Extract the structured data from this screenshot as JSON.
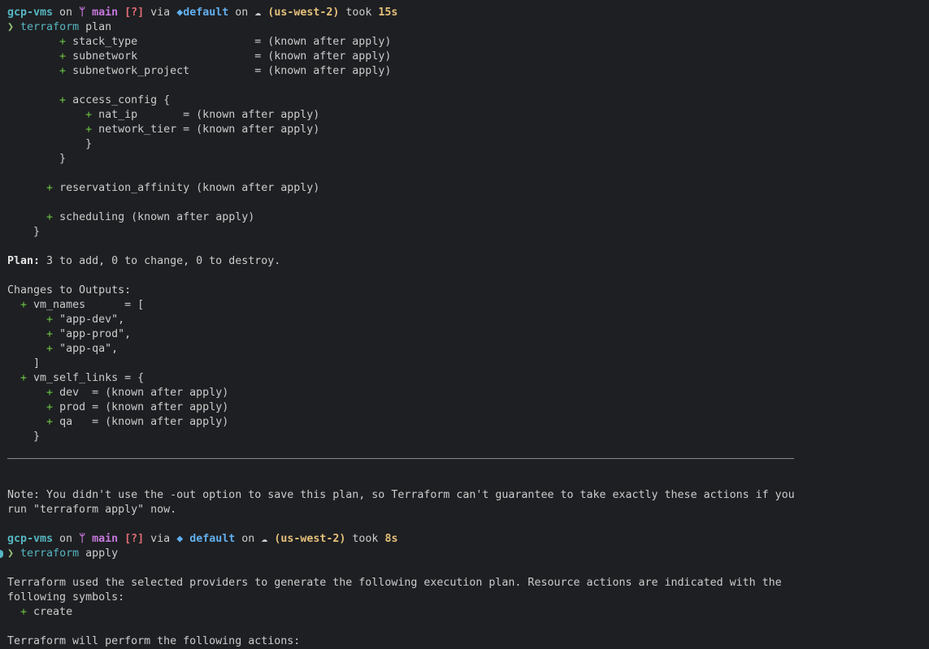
{
  "prompt1": {
    "dir": "gcp-vms",
    "on": " on ",
    "branch_icon": "ᛘ",
    "branch": "main",
    "status": "[?]",
    "via": " via ",
    "ws_icon": "◆",
    "workspace": "default",
    "on2": " on ",
    "cloud_icon": "☁",
    "region": "(us-west-2)",
    "took": " took ",
    "duration": "15s",
    "arrow": "❯",
    "cmd": "terraform",
    "cmd_arg": " plan"
  },
  "plan_lines": [
    {
      "indent": "        ",
      "plus": "+",
      "text": " stack_type                  = (known after apply)"
    },
    {
      "indent": "        ",
      "plus": "+",
      "text": " subnetwork                  = (known after apply)"
    },
    {
      "indent": "        ",
      "plus": "+",
      "text": " subnetwork_project          = (known after apply)"
    },
    {
      "indent": "",
      "plus": "",
      "text": ""
    },
    {
      "indent": "        ",
      "plus": "+",
      "text": " access_config {"
    },
    {
      "indent": "            ",
      "plus": "+",
      "text": " nat_ip       = (known after apply)"
    },
    {
      "indent": "            ",
      "plus": "+",
      "text": " network_tier = (known after apply)"
    },
    {
      "indent": "",
      "plus": "",
      "text": "            }"
    },
    {
      "indent": "",
      "plus": "",
      "text": "        }"
    },
    {
      "indent": "",
      "plus": "",
      "text": ""
    },
    {
      "indent": "      ",
      "plus": "+",
      "text": " reservation_affinity (known after apply)"
    },
    {
      "indent": "",
      "plus": "",
      "text": ""
    },
    {
      "indent": "      ",
      "plus": "+",
      "text": " scheduling (known after apply)"
    },
    {
      "indent": "",
      "plus": "",
      "text": "    }"
    }
  ],
  "plan_summary": {
    "label": "Plan:",
    "text": " 3 to add, 0 to change, 0 to destroy."
  },
  "outputs_header": "Changes to Outputs:",
  "output_lines": [
    {
      "indent": "  ",
      "plus": "+",
      "text": " vm_names      = ["
    },
    {
      "indent": "      ",
      "plus": "+",
      "text": " \"app-dev\","
    },
    {
      "indent": "      ",
      "plus": "+",
      "text": " \"app-prod\","
    },
    {
      "indent": "      ",
      "plus": "+",
      "text": " \"app-qa\","
    },
    {
      "indent": "",
      "plus": "",
      "text": "    ]"
    },
    {
      "indent": "  ",
      "plus": "+",
      "text": " vm_self_links = {"
    },
    {
      "indent": "      ",
      "plus": "+",
      "text": " dev  = (known after apply)"
    },
    {
      "indent": "      ",
      "plus": "+",
      "text": " prod = (known after apply)"
    },
    {
      "indent": "      ",
      "plus": "+",
      "text": " qa   = (known after apply)"
    },
    {
      "indent": "",
      "plus": "",
      "text": "    }"
    }
  ],
  "note": [
    "Note: You didn't use the -out option to save this plan, so Terraform can't guarantee to take exactly these actions if you",
    "run \"terraform apply\" now."
  ],
  "prompt2": {
    "dir": "gcp-vms",
    "on": " on ",
    "branch_icon": "ᛘ",
    "branch": "main",
    "status": "[?]",
    "via": " via ",
    "ws_icon": "◆",
    "workspace": "default",
    "on2": " on ",
    "cloud_icon": "☁",
    "region": "(us-west-2)",
    "took": " took ",
    "duration": "8s",
    "arrow": "❯",
    "cmd": "terraform",
    "cmd_arg": " apply"
  },
  "apply_text": [
    "Terraform used the selected providers to generate the following execution plan. Resource actions are indicated with the",
    "following symbols:"
  ],
  "symbols": {
    "indent": "  ",
    "plus": "+",
    "text": " create"
  },
  "cut_line": "Terraform will perform the following actions:",
  "colors": {
    "background": "#1e1f22",
    "foreground": "#cccccc",
    "cyan": "#56b6c2",
    "purple": "#c678dd",
    "red": "#e06c75",
    "blue": "#61afef",
    "yellow": "#e5c07b",
    "green": "#98c379",
    "plus": "#6cc644"
  }
}
